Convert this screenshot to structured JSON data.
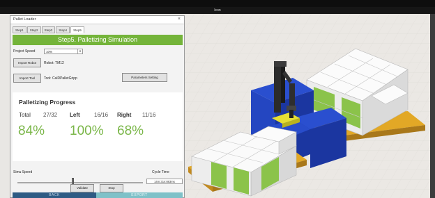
{
  "app": {
    "title": "Icon"
  },
  "dialog": {
    "title": "Pallet Loader",
    "close_glyph": "×",
    "tabs": [
      {
        "label": "Step1"
      },
      {
        "label": "Step2"
      },
      {
        "label": "Step3"
      },
      {
        "label": "Step4"
      },
      {
        "label": "Step5",
        "active": true
      }
    ],
    "banner": "Step5. Palletizing Simulation",
    "project_speed": {
      "label": "Project Speed",
      "value": "10%"
    },
    "import_robot": {
      "button": "Import Robot",
      "info": "Robot: TM12"
    },
    "import_tool": {
      "button": "Import Tool",
      "info": "Tool: CalDPalletGripp"
    },
    "parameters_button": "Parameters Setting",
    "progress": {
      "title": "Palletizing Progress",
      "total": {
        "label": "Total",
        "value": "27/32",
        "percent": "84%"
      },
      "left": {
        "label": "Left",
        "value": "16/16",
        "percent": "100%"
      },
      "right": {
        "label": "Right",
        "value": "11/16",
        "percent": "68%"
      }
    },
    "simu_speed": {
      "label": "Simu Speed",
      "fraction": 0.44
    },
    "cycle_time": {
      "label": "Cycle Time",
      "value": "14m:31s:883ms"
    },
    "validate_button": "Validate",
    "stop_button": "Stop",
    "back_button": "BACK",
    "export_button": "EXPORT"
  },
  "colors": {
    "accent_green": "#74b43a",
    "percent_green": "#7ab648",
    "back_blue": "#2e5b84",
    "export_teal": "#7fc1c8",
    "conveyor_blue": "#1f3fb8",
    "pallet_orange": "#e2a826"
  }
}
